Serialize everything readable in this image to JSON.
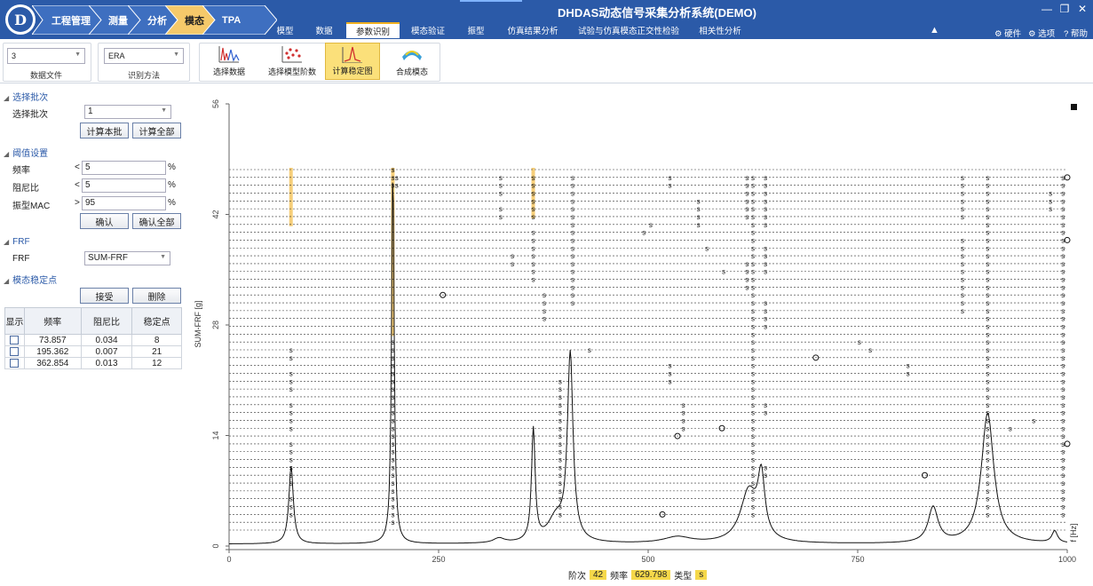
{
  "app": {
    "title": "DHDAS动态信号采集分析系统(DEMO)",
    "logo_text": "D"
  },
  "breadcrumb": [
    "工程管理",
    "测量",
    "分析",
    "模态",
    "TPA"
  ],
  "breadcrumb_active_index": 3,
  "menus": [
    "模型",
    "数据",
    "参数识别",
    "模态验证",
    "振型",
    "仿真结果分析",
    "试验与仿真模态正交性检验",
    "相关性分析"
  ],
  "menu_active_index": 2,
  "right_tools": {
    "hardware": "硬件",
    "options": "选项",
    "help": "帮助"
  },
  "window_buttons": {
    "minimize": "—",
    "restore": "❐",
    "close": "✕"
  },
  "ribbon": {
    "data_file_value": "3",
    "data_file_label": "数据文件",
    "method_value": "ERA",
    "method_label": "识别方法",
    "buttons": [
      "选择数据",
      "选择模型阶数",
      "计算稳定图",
      "合成模态"
    ],
    "active_button_index": 2
  },
  "left": {
    "batch_section": "选择批次",
    "batch_label": "选择批次",
    "batch_value": "1",
    "calc_batch": "计算本批",
    "calc_all": "计算全部",
    "threshold_section": "阈值设置",
    "freq_label": "频率",
    "freq_op": "<",
    "freq_value": "5",
    "damp_label": "阻尼比",
    "damp_op": "<",
    "damp_value": "5",
    "mac_label": "振型MAC",
    "mac_op": ">",
    "mac_value": "95",
    "pct": "%",
    "confirm": "确认",
    "confirm_all": "确认全部",
    "frf_section": "FRF",
    "frf_label": "FRF",
    "frf_value": "SUM-FRF",
    "stable_section": "模态稳定点",
    "accept": "接受",
    "delete": "删除",
    "table_headers": [
      "显示",
      "频率",
      "阻尼比",
      "稳定点"
    ],
    "table_rows": [
      {
        "freq": "73.857",
        "damp": "0.034",
        "count": "8"
      },
      {
        "freq": "195.362",
        "damp": "0.007",
        "count": "21"
      },
      {
        "freq": "362.854",
        "damp": "0.013",
        "count": "12"
      }
    ]
  },
  "status": {
    "order_label": "阶次",
    "order_value": "42",
    "freq_label": "频率",
    "freq_value": "629.798",
    "type_label": "类型",
    "type_value": "s"
  },
  "chart_data": {
    "type": "line",
    "ylabel": "SUM-FRF [g]",
    "xlabel": "f [Hz]",
    "xlim": [
      0,
      1000
    ],
    "ylim": [
      0,
      56
    ],
    "xticks": [
      0,
      250,
      500,
      750,
      1000
    ],
    "yticks": [
      0,
      14,
      28,
      42,
      56
    ],
    "stability_rows": 47,
    "highlight_bands": [
      {
        "x": 73.857,
        "from_order": 40,
        "to_order": 47
      },
      {
        "x": 195.362,
        "from_order": 26,
        "to_order": 47
      },
      {
        "x": 362.854,
        "from_order": 41,
        "to_order": 47
      }
    ],
    "frf_peaks": [
      {
        "f": 74,
        "a": 9.8,
        "w": 3.2
      },
      {
        "f": 195.4,
        "a": 48,
        "w": 1.8
      },
      {
        "f": 322,
        "a": 0.6,
        "w": 8
      },
      {
        "f": 363,
        "a": 14.2,
        "w": 2.6
      },
      {
        "f": 390,
        "a": 3,
        "w": 12
      },
      {
        "f": 407,
        "a": 23.5,
        "w": 4
      },
      {
        "f": 535,
        "a": 0.8,
        "w": 20
      },
      {
        "f": 620,
        "a": 6.5,
        "w": 12
      },
      {
        "f": 635,
        "a": 7.5,
        "w": 5
      },
      {
        "f": 840,
        "a": 4.5,
        "w": 7
      },
      {
        "f": 905,
        "a": 16.5,
        "w": 9
      },
      {
        "f": 985,
        "a": 1.5,
        "w": 4
      }
    ],
    "s_columns": [
      {
        "f": 73.9,
        "orders": [
          3,
          4,
          5,
          7,
          8,
          9,
          10,
          11,
          12,
          14,
          15,
          16,
          17,
          19,
          20,
          21,
          23,
          24
        ]
      },
      {
        "f": 195.4,
        "orders": [
          2,
          3,
          4,
          5,
          6,
          7,
          8,
          9,
          10,
          11,
          12,
          13,
          14,
          15,
          16,
          17,
          18,
          19,
          20,
          21,
          22,
          23,
          24,
          25,
          45,
          46,
          47
        ]
      },
      {
        "f": 200,
        "orders": [
          45,
          46
        ]
      },
      {
        "f": 324,
        "orders": [
          41,
          42,
          44,
          45,
          46
        ]
      },
      {
        "f": 338,
        "orders": [
          35,
          36
        ]
      },
      {
        "f": 363,
        "orders": [
          33,
          34,
          35,
          36,
          37,
          38,
          39,
          41,
          42,
          43,
          44,
          45,
          46
        ]
      },
      {
        "f": 376,
        "orders": [
          28,
          29,
          30,
          31
        ]
      },
      {
        "f": 395,
        "orders": [
          3,
          4,
          5,
          6,
          7,
          8,
          9,
          10,
          11,
          12,
          13,
          14,
          15,
          16,
          17,
          18,
          19,
          20
        ]
      },
      {
        "f": 410,
        "orders": [
          30,
          31,
          32,
          33,
          34,
          35,
          36,
          37,
          38,
          39,
          40,
          41,
          42,
          43,
          44,
          45,
          46
        ]
      },
      {
        "f": 430,
        "orders": [
          24
        ]
      },
      {
        "f": 495,
        "orders": [
          39
        ]
      },
      {
        "f": 503,
        "orders": [
          40
        ]
      },
      {
        "f": 526,
        "orders": [
          20,
          21,
          22,
          45,
          46
        ]
      },
      {
        "f": 542,
        "orders": [
          14,
          15,
          16,
          17
        ]
      },
      {
        "f": 560,
        "orders": [
          40,
          41,
          42,
          43
        ]
      },
      {
        "f": 570,
        "orders": [
          37
        ]
      },
      {
        "f": 590,
        "orders": [
          34
        ]
      },
      {
        "f": 618,
        "orders": [
          32,
          33,
          34,
          35,
          41,
          42,
          43,
          44,
          45,
          46
        ]
      },
      {
        "f": 625,
        "orders": [
          3,
          4,
          5,
          6,
          7,
          8,
          9,
          10,
          11,
          12,
          13,
          14,
          15,
          16,
          17,
          18,
          19,
          20,
          21,
          22,
          23,
          24,
          25,
          26,
          27,
          28,
          29,
          30,
          31,
          32,
          33,
          34,
          35,
          36,
          37,
          38,
          39,
          40,
          41,
          42,
          43,
          44,
          45,
          46
        ]
      },
      {
        "f": 640,
        "orders": [
          8,
          9,
          16,
          17,
          27,
          28,
          29,
          30,
          34,
          35,
          36,
          37,
          40,
          41,
          42,
          43,
          44,
          45,
          46
        ]
      },
      {
        "f": 752,
        "orders": [
          25
        ]
      },
      {
        "f": 765,
        "orders": [
          24
        ]
      },
      {
        "f": 810,
        "orders": [
          21,
          22
        ]
      },
      {
        "f": 875,
        "orders": [
          29,
          30,
          31,
          32,
          33,
          34,
          35,
          36,
          37,
          38,
          41,
          42,
          43,
          44,
          45,
          46
        ]
      },
      {
        "f": 905,
        "orders": [
          3,
          4,
          5,
          6,
          7,
          8,
          9,
          10,
          11,
          12,
          13,
          14,
          15,
          16,
          17,
          18,
          19,
          20,
          21,
          22,
          23,
          24,
          25,
          26,
          27,
          28,
          29,
          30,
          31,
          32,
          33,
          34,
          35,
          36,
          37,
          38,
          39,
          40,
          41,
          42,
          43,
          44,
          45,
          46
        ]
      },
      {
        "f": 932,
        "orders": [
          14
        ]
      },
      {
        "f": 960,
        "orders": [
          15
        ]
      },
      {
        "f": 980,
        "orders": [
          42,
          43,
          44
        ]
      },
      {
        "f": 995,
        "orders": [
          3,
          4,
          5,
          6,
          7,
          8,
          9,
          10,
          11,
          12,
          13,
          14,
          15,
          16,
          17,
          18,
          19,
          20,
          21,
          22,
          23,
          24,
          25,
          26,
          27,
          28,
          29,
          30,
          31,
          32,
          33,
          34,
          35,
          36,
          37,
          38,
          39,
          40,
          41,
          42,
          43,
          44,
          45,
          46
        ]
      }
    ],
    "o_points": [
      {
        "f": 255,
        "order": 31
      },
      {
        "f": 517,
        "order": 3
      },
      {
        "f": 535,
        "order": 13
      },
      {
        "f": 588,
        "order": 14
      },
      {
        "f": 700,
        "order": 23
      },
      {
        "f": 830,
        "order": 8
      },
      {
        "f": 1000,
        "order": 12
      },
      {
        "f": 1000,
        "order": 38
      },
      {
        "f": 1000,
        "order": 46
      }
    ]
  },
  "colors": {
    "titlebar": "#2b5aa8",
    "accent": "#f0b020",
    "highlight_band": "#f5c96a"
  }
}
